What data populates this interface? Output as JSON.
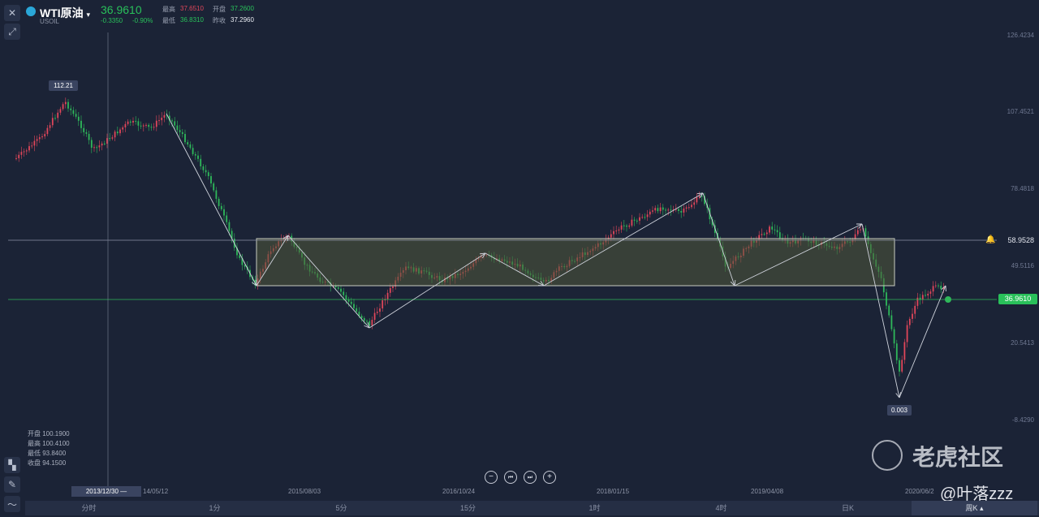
{
  "header": {
    "symbol_name": "WTI原油",
    "symbol_code": "USOIL",
    "price": "36.9610",
    "change": "-0.3350",
    "change_pct": "-0.90%",
    "high_label": "最高",
    "high_value": "37.6510",
    "open_label": "开盘",
    "open_value": "37.2600",
    "low_label": "最低",
    "low_value": "36.8310",
    "prev_label": "昨收",
    "prev_value": "37.2960"
  },
  "y_axis": [
    "126.4234",
    "107.4521",
    "78.4818",
    "49.5116",
    "20.5413",
    "-8.4290"
  ],
  "price_markers": {
    "ref_level": "58.9528",
    "current": "36.9610",
    "peak": "112.21",
    "low": "0.003"
  },
  "x_axis": {
    "crosshair_date": "2013/12/30 —",
    "dates": [
      "14/05/12",
      "2015/08/03",
      "2016/10/24",
      "2018/01/15",
      "2019/04/08",
      "2020/06/2"
    ]
  },
  "ohlc_panel": {
    "open_label": "开盘",
    "open": "100.1900",
    "high_label": "最高",
    "high": "100.4100",
    "low_label": "最低",
    "low": "93.8400",
    "close_label": "收盘",
    "close": "94.1500"
  },
  "timeframes": [
    "分时",
    "1分",
    "5分",
    "15分",
    "1时",
    "4时",
    "日K",
    "周K"
  ],
  "active_timeframe": "周K",
  "watermark": {
    "brand": "老虎社区",
    "user": "@叶落zzz"
  },
  "colors": {
    "up": "#e0465a",
    "down": "#2fb85a",
    "background": "#1b2336",
    "accent_green": "#29c05a"
  },
  "icons": [
    "close-icon",
    "expand-icon",
    "indicator-icon",
    "draw-icon",
    "line-icon",
    "alert-icon",
    "zoom-out-icon",
    "rewind-icon",
    "forward-icon",
    "zoom-in-icon"
  ]
}
